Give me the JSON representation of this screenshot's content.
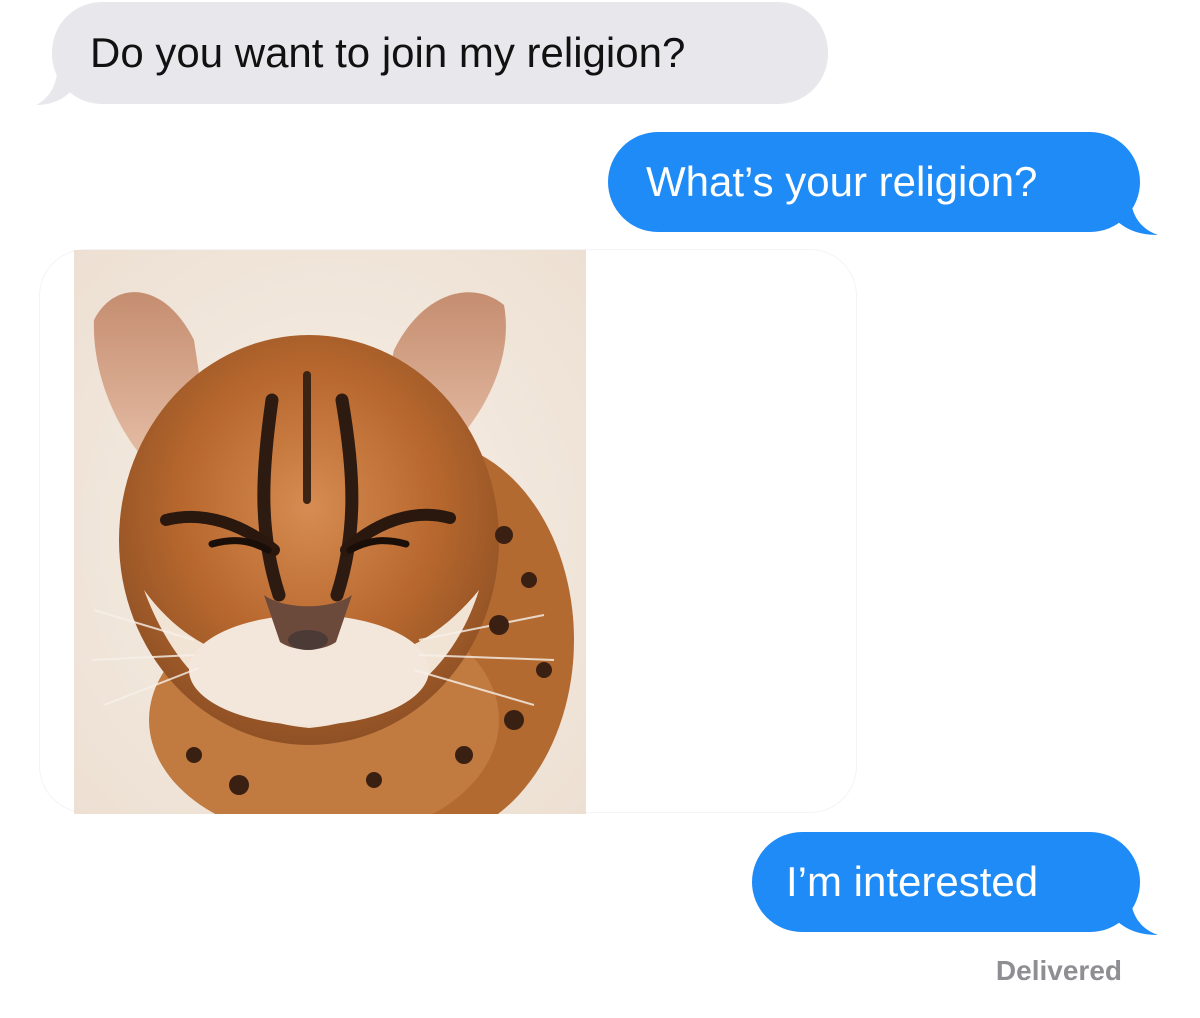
{
  "messages": [
    {
      "direction": "received",
      "text": "Do you want to join my religion?"
    },
    {
      "direction": "sent",
      "text": "What’s your religion?"
    },
    {
      "direction": "received",
      "attachment": "leopard-cat-photo"
    },
    {
      "direction": "sent",
      "text": "I’m interested"
    }
  ],
  "delivery_status": "Delivered",
  "colors": {
    "sent_bubble": "#1e8bf7",
    "received_bubble": "#e8e8ec",
    "sent_text": "#ffffff",
    "received_text": "#111111",
    "status_text": "#8e8e93"
  }
}
